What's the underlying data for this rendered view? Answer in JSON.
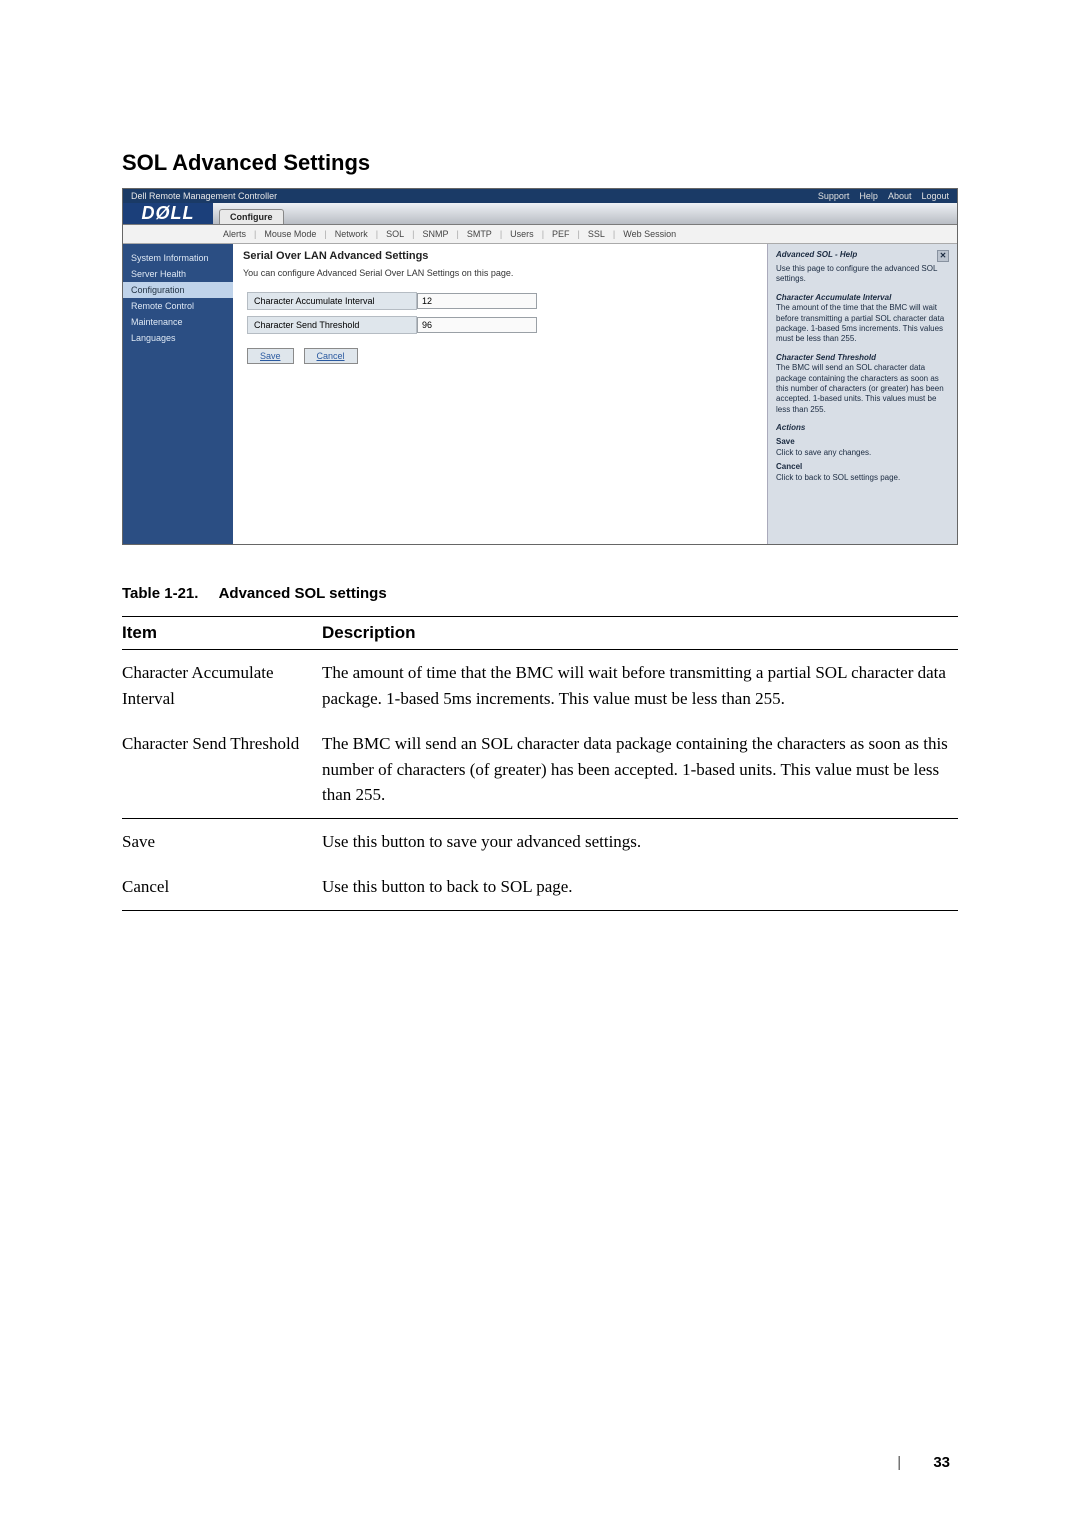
{
  "section_title": "SOL Advanced Settings",
  "screenshot": {
    "chrome_title": "Dell Remote Management Controller",
    "top_links": [
      "Support",
      "Help",
      "About",
      "Logout"
    ],
    "logo_text": "DØLL",
    "main_tab": "Configure",
    "sub_tabs": [
      "Alerts",
      "Mouse Mode",
      "Network",
      "SOL",
      "SNMP",
      "SMTP",
      "Users",
      "PEF",
      "SSL",
      "Web Session"
    ],
    "sidebar": {
      "items": [
        "System Information",
        "Server Health",
        "Configuration",
        "Remote Control",
        "Maintenance",
        "Languages"
      ],
      "active_index": 2
    },
    "content": {
      "heading": "Serial Over LAN Advanced Settings",
      "desc": "You can configure Advanced Serial Over LAN Settings on this page.",
      "rows": [
        {
          "label": "Character Accumulate Interval",
          "value": "12"
        },
        {
          "label": "Character Send Threshold",
          "value": "96"
        }
      ],
      "save_label": "Save",
      "cancel_label": "Cancel"
    },
    "help": {
      "title": "Advanced SOL - Help",
      "intro": "Use this page to configure the advanced SOL settings.",
      "sec1_head": "Character Accumulate Interval",
      "sec1_body": "The amount of the time that the BMC will wait before transmitting a partial SOL character data package. 1-based 5ms increments. This values must be less than 255.",
      "sec2_head": "Character Send Threshold",
      "sec2_body": "The BMC will send an SOL character data package containing the characters as soon as this number of characters (or greater) has been accepted. 1-based units. This values must be less than 255.",
      "actions_head": "Actions",
      "save_head": "Save",
      "save_body": "Click to save any changes.",
      "cancel_head": "Cancel",
      "cancel_body": "Click to back to SOL settings page."
    }
  },
  "table": {
    "caption_num": "Table 1-21.",
    "caption_title": "Advanced SOL settings",
    "headers": [
      "Item",
      "Description"
    ],
    "rows": [
      {
        "item": "Character Accumulate Interval",
        "desc": "The amount of time that the BMC will wait before transmitting a partial SOL character data package. 1-based 5ms increments. This value must be less than 255."
      },
      {
        "item": "Character Send Threshold",
        "desc": "The BMC will send an SOL character data package containing the characters as soon as this number of characters (of greater) has been accepted. 1-based units. This value must be less than 255."
      },
      {
        "item": "Save",
        "desc": "Use this button to save your advanced settings."
      },
      {
        "item": "Cancel",
        "desc": "Use this button to back to SOL page."
      }
    ]
  },
  "page_number": "33"
}
